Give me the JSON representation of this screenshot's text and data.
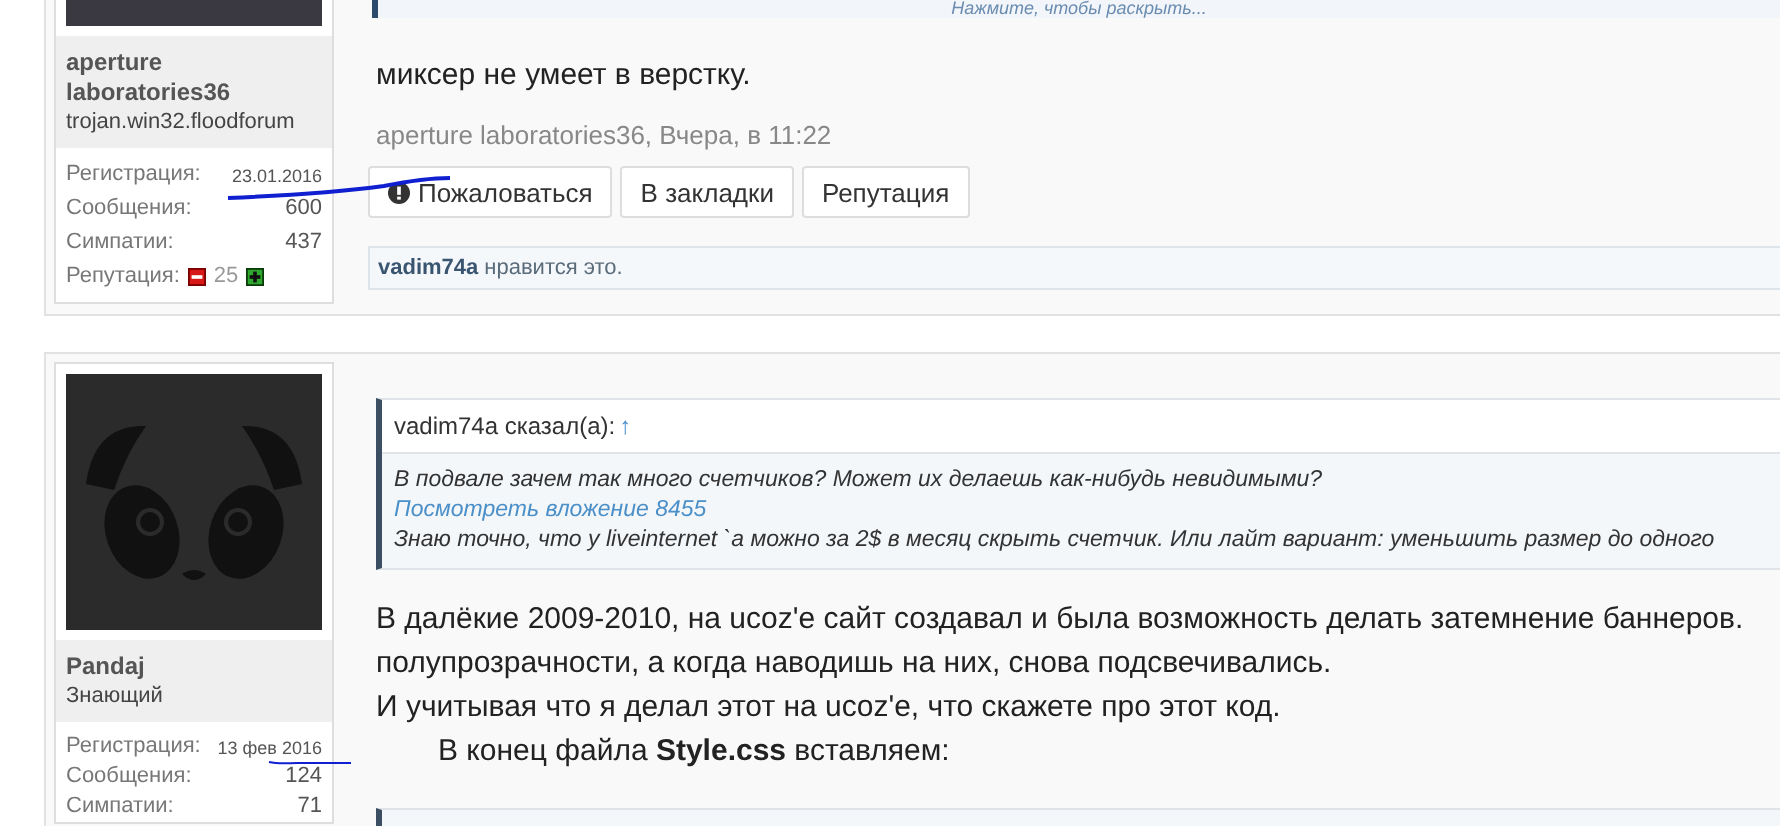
{
  "posts": [
    {
      "author": {
        "name": "aperture laboratories36",
        "title": "trojan.win32.floodforum",
        "avatar": {
          "kind": "photo"
        },
        "stats": [
          {
            "label": "Регистрация:",
            "value": "23.01.2016",
            "small": true
          },
          {
            "label": "Сообщения:",
            "value": "600",
            "small": false
          },
          {
            "label": "Симпатии:",
            "value": "437",
            "small": false
          }
        ],
        "reputation": {
          "label": "Репутация:",
          "value": "25"
        }
      },
      "quote_expand": "Нажмите, чтобы раскрыть...",
      "paragraphs": [
        {
          "text": "миксер не умеет в верстку.",
          "indent": false
        }
      ],
      "meta": "aperture laboratories36, Вчера, в 11:22",
      "actions": [
        {
          "label": "Пожаловаться",
          "icon": true
        },
        {
          "label": "В закладки",
          "icon": false
        },
        {
          "label": "Репутация",
          "icon": false
        }
      ],
      "likes": {
        "user": "vadim74a",
        "text": "нравится это."
      }
    },
    {
      "author": {
        "name": "Pandaj",
        "title": "Знающий",
        "avatar": {
          "kind": "panda"
        },
        "stats": [
          {
            "label": "Регистрация:",
            "value": "13 фев 2016",
            "small": true
          },
          {
            "label": "Сообщения:",
            "value": "124",
            "small": false
          },
          {
            "label": "Симпатии:",
            "value": "71",
            "small": false
          }
        ]
      },
      "quote": {
        "author": "vadim74a сказал(а):",
        "arrow": "↑",
        "lines": [
          {
            "kind": "text",
            "text": "В подвале зачем так много счетчиков? Может их делаешь как-нибудь невидимыми?"
          },
          {
            "kind": "link",
            "text": "Посмотреть вложение 8455"
          },
          {
            "kind": "text",
            "text": "Знаю точно, что у liveinternet `a можно за 2$ в месяц скрыть счетчик. Или лайт вариант: уменьшить размер до одного"
          }
        ]
      },
      "paragraphs": [
        {
          "text": "В далёкие 2009-2010, на ucoz'e сайт создавал и была возможность делать затемнение баннеров.",
          "indent": false
        },
        {
          "text": "полупрозрачности, а когда наводишь на них, снова подсвечивались.",
          "indent": false
        },
        {
          "text": "И учитывая что я делал этот на ucoz'e, что скажете про этот код.",
          "indent": false
        },
        {
          "text": "В конец файла **Style.css** вставляем:",
          "indent": true
        }
      ],
      "code_block": true
    }
  ]
}
